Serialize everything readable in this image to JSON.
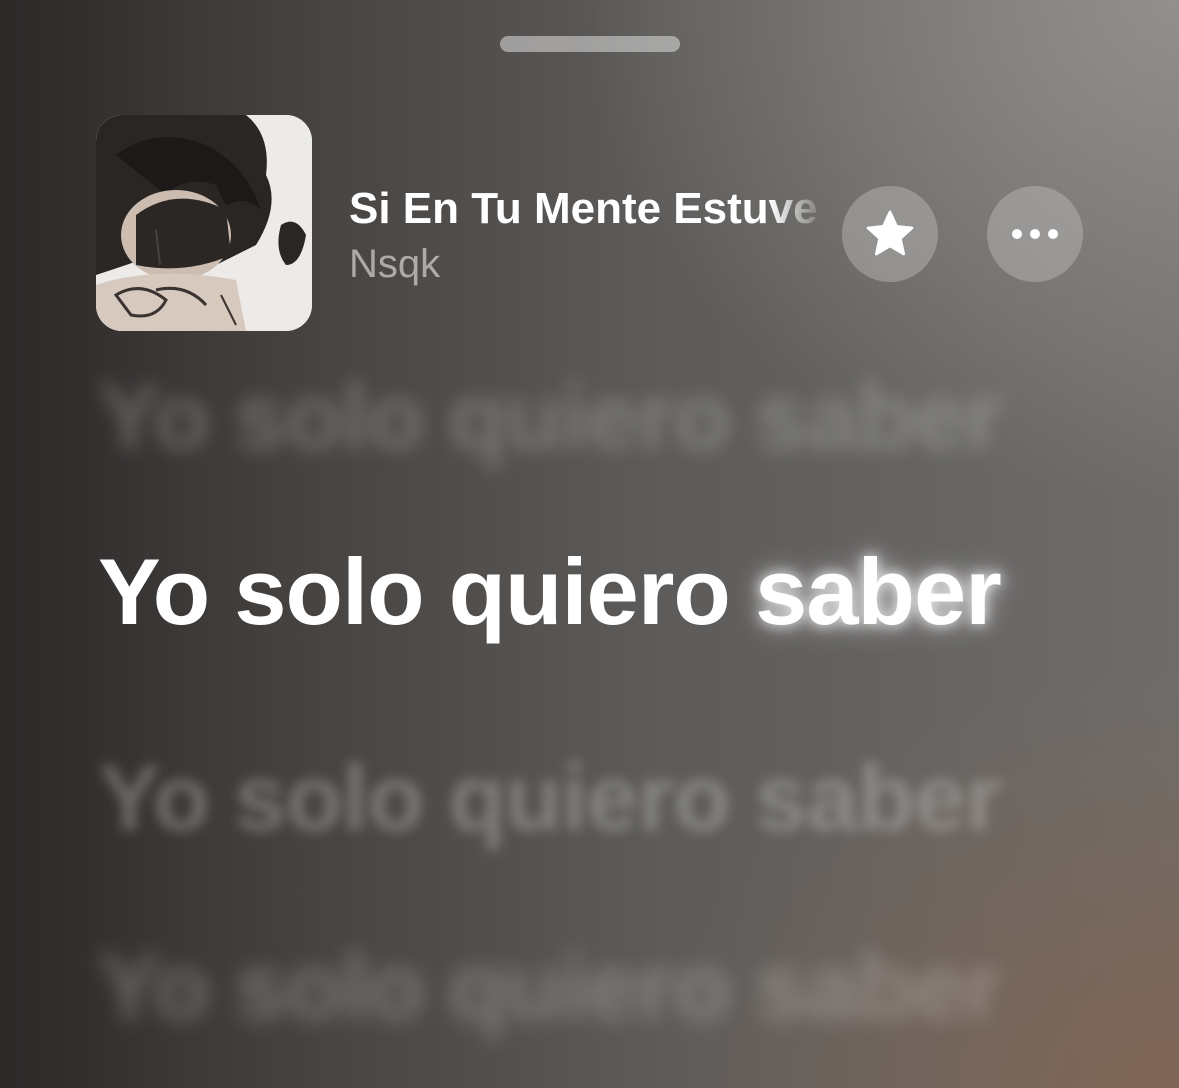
{
  "now_playing": {
    "title": "Si En Tu Mente Estuve",
    "artist": "Nsqk",
    "artwork": "album-artwork"
  },
  "actions": {
    "favorite_icon": "star-icon",
    "more_icon": "ellipsis-icon"
  },
  "lyrics": {
    "previous": "Yo solo quiero saber",
    "current_sung": "Yo solo quiero",
    "current_active": "saber",
    "next": [
      "Yo solo quiero saber",
      "Yo solo quiero saber"
    ]
  }
}
